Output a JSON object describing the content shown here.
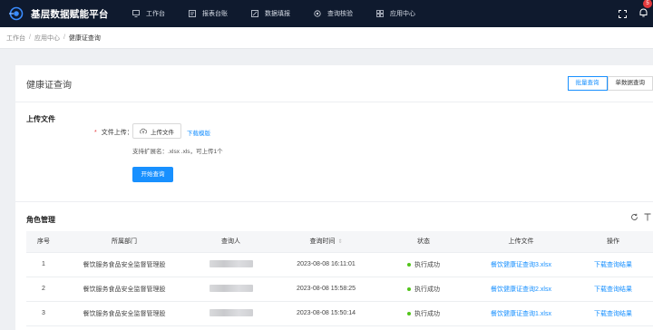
{
  "app": {
    "title": "基层数据赋能平台"
  },
  "nav": [
    {
      "label": "工作台",
      "icon": "monitor-icon"
    },
    {
      "label": "报表台账",
      "icon": "report-icon"
    },
    {
      "label": "数据填报",
      "icon": "fill-data-icon"
    },
    {
      "label": "查询核验",
      "icon": "query-verify-icon"
    },
    {
      "label": "应用中心",
      "icon": "app-grid-icon"
    }
  ],
  "header": {
    "notification_count": "5"
  },
  "breadcrumb": {
    "items": [
      "工作台",
      "应用中心",
      "健康证查询"
    ],
    "separator": "/"
  },
  "page": {
    "title": "健康证查询",
    "modes": [
      {
        "label": "批量查询",
        "active": true
      },
      {
        "label": "单数据查询",
        "active": false
      }
    ]
  },
  "upload": {
    "section_title": "上传文件",
    "field_label": "文件上传：",
    "button_label": "上传文件",
    "template_link": "下载模版",
    "hint": "支持扩展名：.xlsx .xls，可上传1个",
    "start_button": "开始查询"
  },
  "roles": {
    "section_title": "角色管理",
    "columns": [
      "序号",
      "所属部门",
      "查询人",
      "查询时间",
      "状态",
      "上传文件",
      "操作"
    ],
    "rows": [
      {
        "index": "1",
        "dept": "餐饮服务食品安全监督管理股",
        "time": "2023-08-08 16:11:01",
        "status": "执行成功",
        "file": "餐饮健康证查询3.xlsx",
        "action": "下载查询结果"
      },
      {
        "index": "2",
        "dept": "餐饮服务食品安全监督管理股",
        "time": "2023-08-08 15:58:25",
        "status": "执行成功",
        "file": "餐饮健康证查询2.xlsx",
        "action": "下载查询结果"
      },
      {
        "index": "3",
        "dept": "餐饮服务食品安全监督管理股",
        "time": "2023-08-08 15:50:14",
        "status": "执行成功",
        "file": "餐饮健康证查询1.xlsx",
        "action": "下载查询结果"
      }
    ]
  },
  "colors": {
    "topbar": "#0f1a2e",
    "accent": "#1890ff",
    "success": "#52c41a",
    "danger": "#e4393c"
  }
}
